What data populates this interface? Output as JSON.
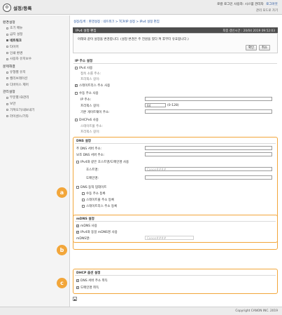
{
  "header": {
    "app_title": "설정/등록",
    "user_info": "로컬 로그인 사용자: 시스템 관리자",
    "logout": "로그아웃",
    "portal_link": "관리 모드로 가기"
  },
  "sidebar": {
    "groups": [
      {
        "title": "환경설정",
        "items": [
          {
            "label": "초기 메뉴",
            "active": false
          },
          {
            "label": "급지 설정",
            "active": false
          },
          {
            "label": "네트워크",
            "active": true
          },
          {
            "label": "타이머",
            "active": false
          },
          {
            "label": "인쇄 환경",
            "active": false
          },
          {
            "label": "사용자 유지보수",
            "active": false
          }
        ]
      },
      {
        "title": "문제해결",
        "items": [
          {
            "label": "유형별 유지",
            "active": false
          },
          {
            "label": "캘리브레이션",
            "active": false
          },
          {
            "label": "디바이스 제어",
            "active": false
          }
        ]
      },
      {
        "title": "관리설정",
        "items": [
          {
            "label": "부문별 ID관리",
            "active": false
          },
          {
            "label": "보안",
            "active": false
          },
          {
            "label": "가져오기/내보내기",
            "active": false
          },
          {
            "label": "라이센스/기타",
            "active": false
          }
        ]
      }
    ]
  },
  "breadcrumb": "설정/등록 : 환경설정 : 네트워크 > TCP/IP 설정 > IPv4 설정 편집",
  "panel": {
    "title": "IPv4 설정 편집",
    "timestamp": "최종 갱신시간 : 20/04 2019 09:52:03",
    "notice": "아래와 같이 설정을 변경합니다. (설정 변경은 주 전원을 껐다 켜 후부터 유효합니다.)",
    "ok_label": "확인",
    "cancel_label": "취소"
  },
  "ip_section": {
    "title": "IP 주소 설정",
    "auto_ip": {
      "label": "IPv4 사용",
      "checked": false
    },
    "auto_sub1": "접속 소를 주소:",
    "auto_sub2": "프리픽스 길이:",
    "stateless": {
      "label": "스테이트리스 주소 사용",
      "checked": true
    },
    "manual": {
      "label": "수동 주소 사용",
      "checked": false
    },
    "ip_label": "IP 주소:",
    "prefix_label": "프리픽스 길이:",
    "prefix_value": "64",
    "prefix_range": "(0-128)",
    "gateway_label": "기본 게이트웨이 주소:",
    "dhcp": {
      "label": "DHCPv6 사용",
      "checked": false
    },
    "dhcp_sub1": "스테이트풀 주소:",
    "dhcp_sub2": "프리픽스 길이:"
  },
  "dns_section": {
    "badge": "a",
    "title": "DNS 설정",
    "primary_label": "주 DNS 서버 주소:",
    "secondary_label": "보조 DNS 서버 주소:",
    "same_host": {
      "label": "IPv4와 같은 호스트명/도메인명 사용",
      "checked": false
    },
    "host_label": "호스트명:",
    "host_value": "Canon####",
    "domain_label": "도메인명:",
    "dyn_update": {
      "label": "DNS 동적 업데이트",
      "checked": false
    },
    "manual_reg": {
      "label": "수동 주소 등록",
      "checked": false
    },
    "stateful_reg": {
      "label": "스테이트풀 주소 등록",
      "checked": false
    },
    "stateless_reg": {
      "label": "스테이트리스 주소 등록",
      "checked": false
    }
  },
  "mdns_section": {
    "badge": "b",
    "title": "mDNS 설정",
    "use_mdns": {
      "label": "mDNS 사용",
      "checked": true
    },
    "same_ipv4": {
      "label": "IPv4와 동일 mDNS명 사용",
      "checked": true
    },
    "name_label": "mDNS명:",
    "name_value": "Canon####"
  },
  "dhcp_section": {
    "badge": "c",
    "title": "DHCP 옵션 설정",
    "dns_server": {
      "label": "DNS 서버 주소 취득",
      "checked": true
    },
    "domain_name": {
      "label": "도메인명 취득",
      "checked": true
    }
  },
  "footer": {
    "copyright": "Copyright CANON INC. 2019",
    "page_glyph": "▲"
  },
  "colors": {
    "highlight": "#f2a63a",
    "title_bar": "#4e4e4e",
    "link": "#1f4f9c"
  }
}
